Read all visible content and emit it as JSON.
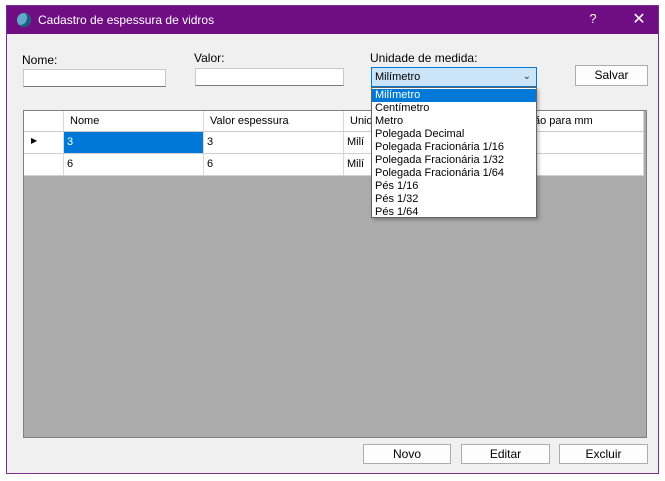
{
  "window": {
    "title": "Cadastro de espessura de vidros",
    "help": "?",
    "close": "✕"
  },
  "form": {
    "nome_label": "Nome:",
    "nome_value": "",
    "valor_label": "Valor:",
    "valor_value": "",
    "unidade_label": "Unidade de medida:",
    "unidade_selected": "Milímetro",
    "save_label": "Salvar"
  },
  "dropdown": {
    "options": [
      "Milímetro",
      "Centímetro",
      "Metro",
      "Polegada Decimal",
      "Polegada Fracionária 1/16",
      "Polegada Fracionária 1/32",
      "Polegada Fracionária 1/64",
      "Pés 1/16",
      "Pés 1/32",
      "Pés 1/64"
    ],
    "selected_index": 0
  },
  "grid": {
    "columns": [
      "Nome",
      "Valor espessura",
      "Unid",
      "ão para mm"
    ],
    "rows": [
      {
        "indicator": "▶",
        "nome": "3",
        "valor": "3",
        "unidade": "Milí",
        "conv": ""
      },
      {
        "indicator": "",
        "nome": "6",
        "valor": "6",
        "unidade": "Milí",
        "conv": ""
      }
    ]
  },
  "footer": {
    "novo": "Novo",
    "editar": "Editar",
    "excluir": "Excluir"
  }
}
